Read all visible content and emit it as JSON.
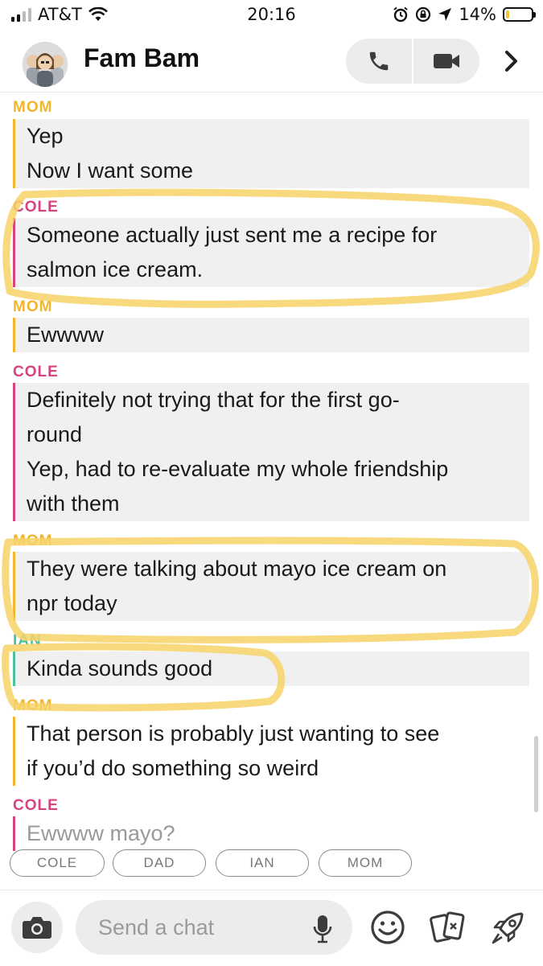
{
  "status_bar": {
    "carrier": "AT&T",
    "time": "20:16",
    "battery": "14%",
    "battery_level": 0.14
  },
  "header": {
    "title": "Fam Bam",
    "avatar_icon": "group-bitmoji-avatar",
    "call_icon": "phone-icon",
    "video_icon": "video-camera-icon",
    "nav_icon": "chevron-right-icon"
  },
  "messages": [
    {
      "sender": "MOM",
      "lines": [
        "Yep",
        "Now I want some"
      ]
    },
    {
      "sender": "COLE",
      "lines": [
        "Someone actually just sent me a recipe for",
        "salmon ice cream."
      ]
    },
    {
      "sender": "MOM",
      "lines": [
        "Ewwww"
      ]
    },
    {
      "sender": "COLE",
      "lines": [
        "Definitely not trying that for the first go-",
        "round",
        "Yep, had to re-evaluate my whole friendship",
        "with them"
      ]
    },
    {
      "sender": "MOM",
      "lines": [
        "They were talking about mayo ice cream on",
        "npr today"
      ]
    },
    {
      "sender": "IAN",
      "lines": [
        "Kinda sounds good"
      ]
    },
    {
      "sender": "MOM",
      "lines": [
        "That person is probably just wanting to see",
        "if you’d do something so weird"
      ]
    },
    {
      "sender": "COLE",
      "lines": [
        "Ewwww mayo?"
      ]
    }
  ],
  "member_chips": [
    "COLE",
    "DAD",
    "IAN",
    "MOM"
  ],
  "composer": {
    "placeholder": "Send a chat",
    "camera_icon": "camera-icon",
    "mic_icon": "microphone-icon",
    "bitmoji_icon": "smiley-icon",
    "sticker_icon": "sticker-cards-icon",
    "games_icon": "rocket-icon"
  },
  "colors": {
    "mom": "#f2b52e",
    "cole": "#d6437f",
    "ian": "#4cbfa0",
    "highlight": "#f7d267"
  }
}
